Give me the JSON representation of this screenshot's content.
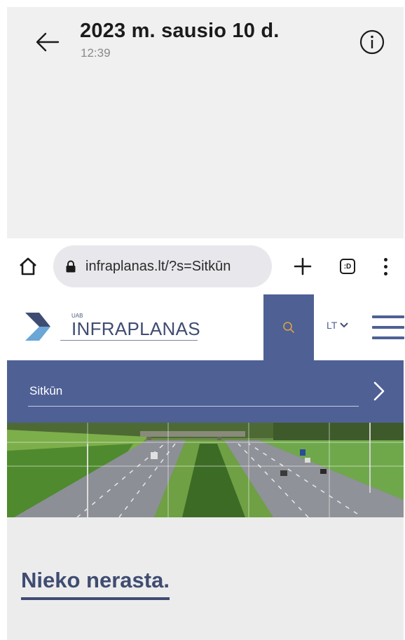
{
  "viewer": {
    "title": "2023 m. sausio 10 d.",
    "time": "12:39",
    "icons": {
      "back": "arrow-left-icon",
      "info": "info-icon"
    }
  },
  "browser": {
    "url": "infraplanas.lt/?s=Sitkūn",
    "tabs_label": ":D",
    "icons": {
      "home": "home-icon",
      "lock": "lock-icon",
      "new_tab": "plus-icon",
      "menu": "vertical-dots-icon"
    }
  },
  "site": {
    "logo": {
      "prefix": "UAB",
      "name": "INFRAPLANAS"
    },
    "lang": "LT",
    "search": {
      "value": "Sitkūn"
    },
    "result_message": "Nieko nerasta.",
    "colors": {
      "brand": "#4f6095",
      "text_dark": "#3f4c72",
      "logo_light": "#6aa6d6"
    }
  }
}
